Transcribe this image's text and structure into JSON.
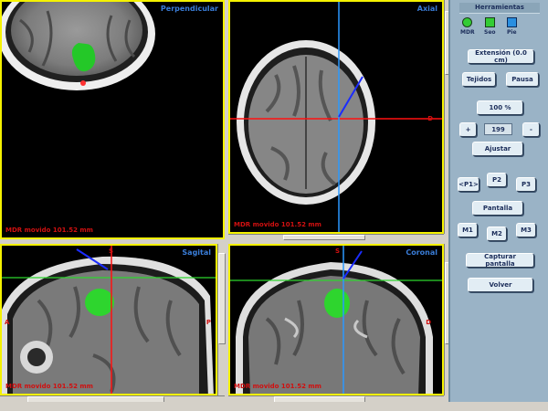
{
  "views": {
    "perpendicular": {
      "title": "Perpendicular",
      "status": "MDR movido 101.52 mm"
    },
    "axial": {
      "title": "Axial",
      "status": "MDR movido 101.52 mm",
      "orient_right": "D"
    },
    "sagital": {
      "title": "Sagital",
      "status": "MDR movido 101.52 mm",
      "orient_top": "S",
      "orient_left": "A",
      "orient_right": "P"
    },
    "coronal": {
      "title": "Coronal",
      "status": "MDR movido 101.52 mm",
      "orient_top": "S",
      "orient_right": "D"
    }
  },
  "panel": {
    "title": "Herramientas",
    "tools": [
      {
        "label": "MDR",
        "color": "#33cc33"
      },
      {
        "label": "Seo",
        "color": "#33cc33"
      },
      {
        "label": "Pie",
        "color": "#2a8fe0"
      }
    ],
    "extension_label": "Extensión (0.0 cm)",
    "tejidos_label": "Tejidos",
    "pausa_label": "Pausa",
    "zoom_label": "100 %",
    "plus_label": "+",
    "value": "199",
    "minus_label": "-",
    "ajustar_label": "Ajustar",
    "p1_label": "<P1>",
    "p2_label": "P2",
    "p3_label": "P3",
    "pantalla_label": "Pantalla",
    "m1_label": "M1",
    "m2_label": "M2",
    "m3_label": "M3",
    "capturar_label": "Capturar pantalla",
    "volver_label": "Volver"
  }
}
